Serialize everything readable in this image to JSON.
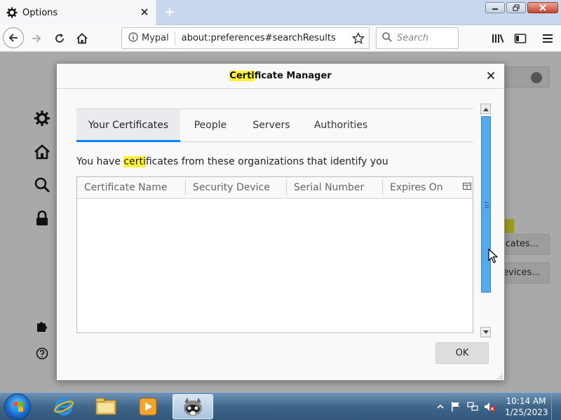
{
  "browser": {
    "tab_title": "Options",
    "identity_label": "Mypal",
    "url": "about:preferences#searchResults",
    "search_placeholder": "Search"
  },
  "background": {
    "button_1_label": "icates...",
    "button_2_label": "evices..."
  },
  "dialog": {
    "title_highlight": "Certi",
    "title_rest": "ficate Manager",
    "tabs": [
      {
        "label": "Your Certificates",
        "active": true
      },
      {
        "label": "People",
        "active": false
      },
      {
        "label": "Servers",
        "active": false
      },
      {
        "label": "Authorities",
        "active": false
      }
    ],
    "description_before": "You have ",
    "description_highlight": "certi",
    "description_after": "ficates from these organizations that identify you",
    "columns": [
      "Certificate Name",
      "Security Device",
      "Serial Number",
      "Expires On"
    ],
    "rows": [],
    "ok_label": "OK"
  },
  "taskbar": {
    "time": "10:14 AM",
    "date": "1/25/2023"
  },
  "colors": {
    "highlight": "#fff137",
    "accent": "#0a84ff",
    "scroll_thumb": "#57a9ec"
  }
}
